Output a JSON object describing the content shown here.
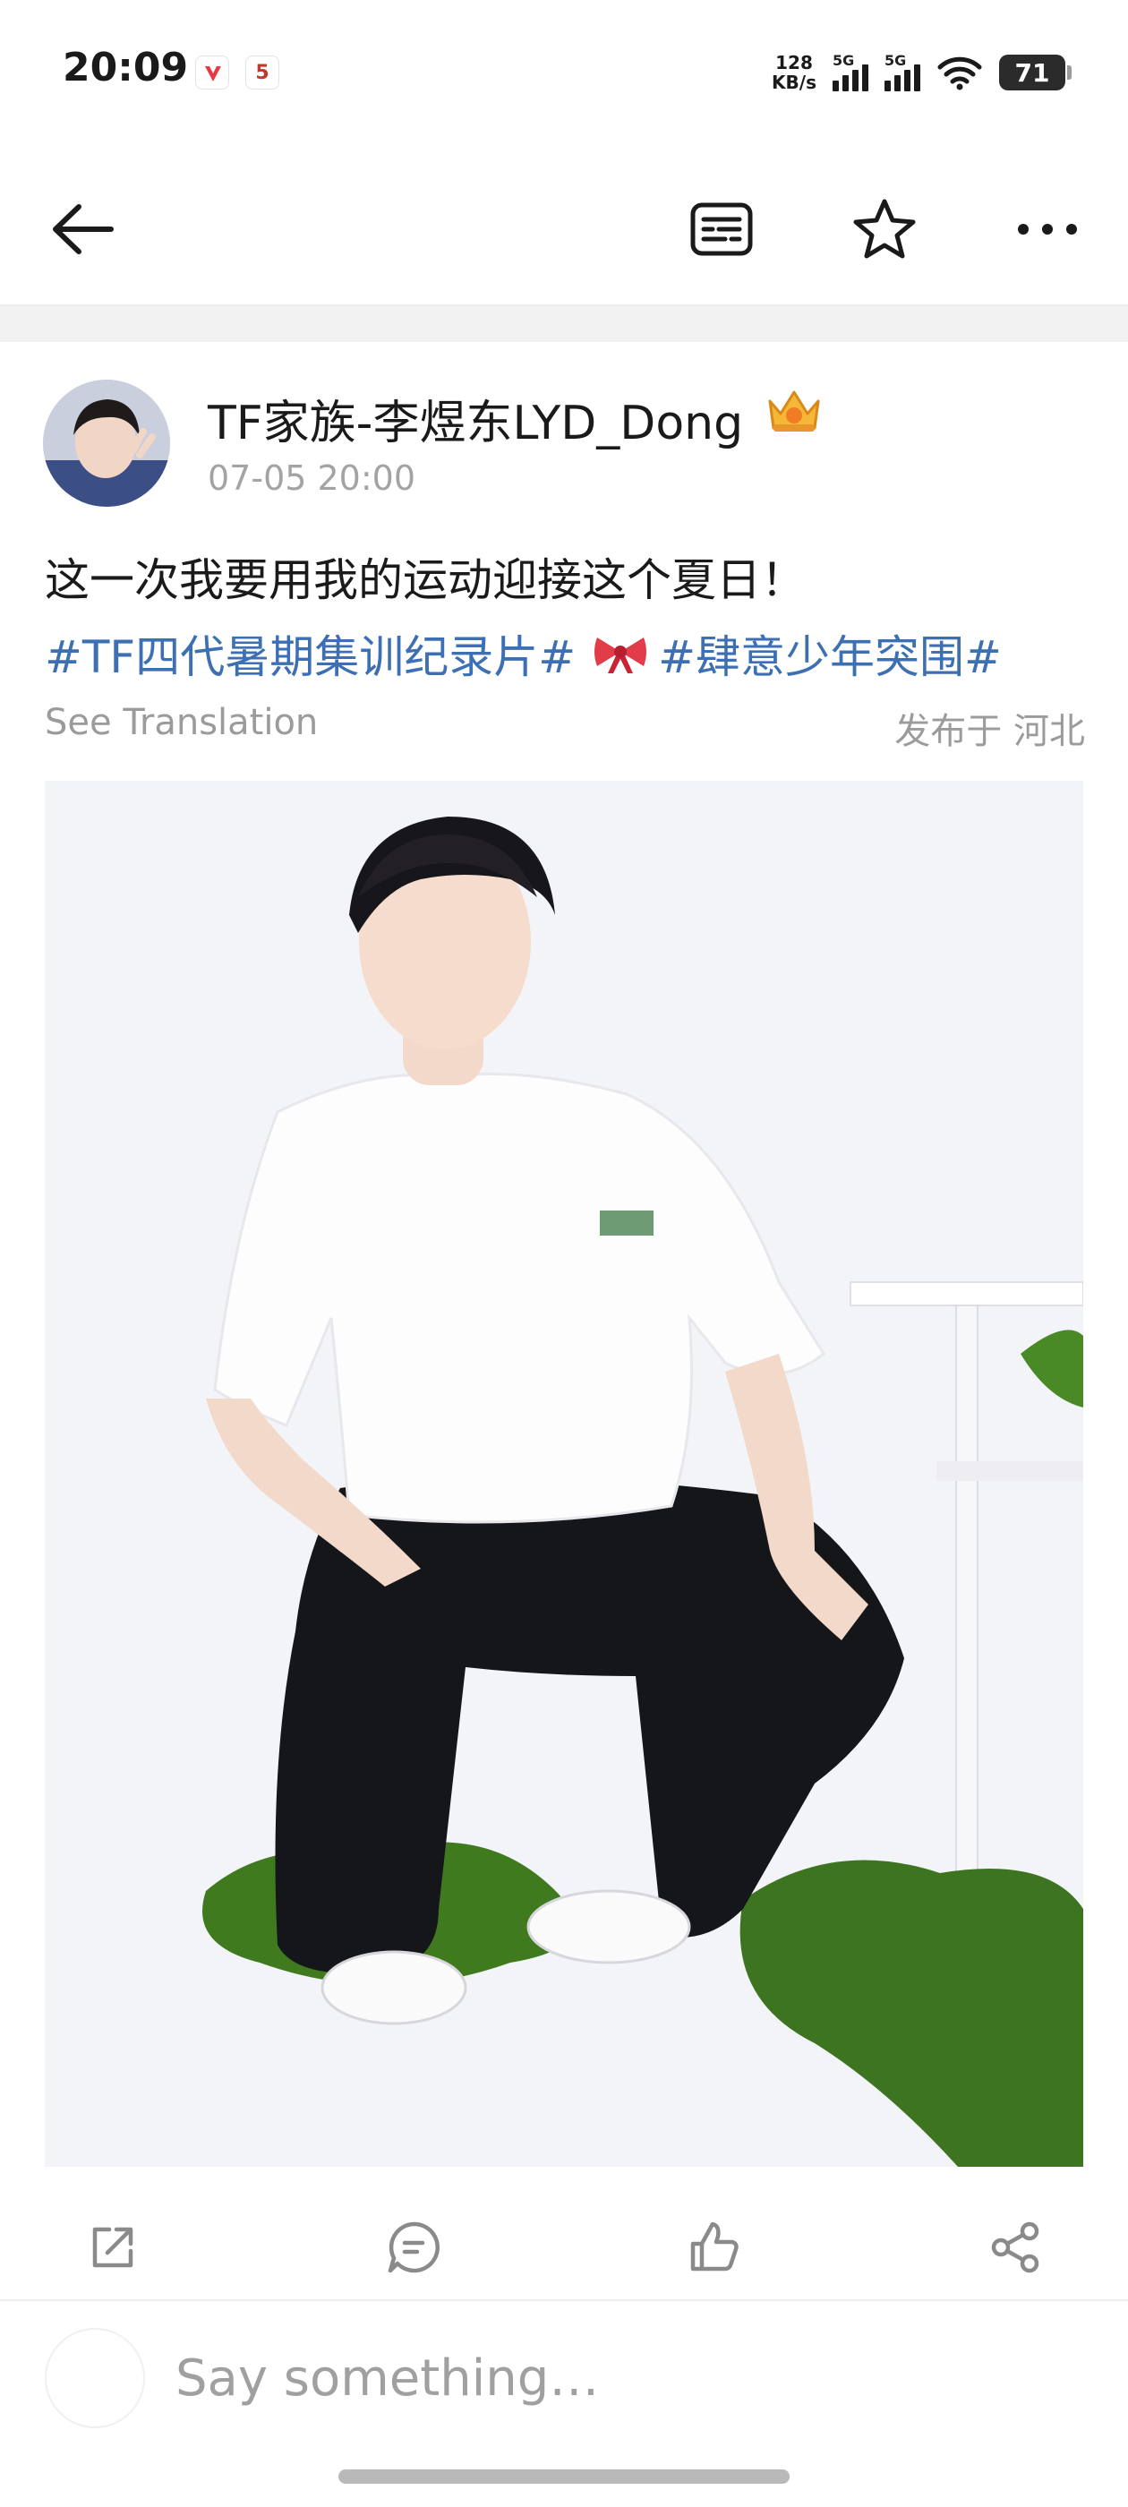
{
  "status_bar": {
    "time": "20:09",
    "app2_badge": "5",
    "net_speed_value": "128",
    "net_speed_unit": "KB/s",
    "sim1_label": "5G",
    "sim2_label": "5G",
    "battery": "71"
  },
  "topnav": {
    "back_icon": "arrow-left-icon",
    "reader_icon": "reader-mode-icon",
    "favorite_icon": "star-icon",
    "more_icon": "more-dots-icon"
  },
  "post": {
    "author": "TF家族-李煜东LYD_Dong",
    "author_badge_icon": "crown-icon",
    "time": "07-05 20:00",
    "text": "这一次我要用我的运动迎接这个夏日！",
    "tag1": "#TF四代暑期集训纪录片#",
    "tag2": "#肆意少年突围#",
    "see_translation": "See Translation",
    "location": "发布于 河北"
  },
  "actions": {
    "repost_icon": "repost-icon",
    "comment_icon": "comment-icon",
    "like_icon": "like-icon",
    "share_icon": "share-icon"
  },
  "comment": {
    "placeholder": "Say something…"
  },
  "colors": {
    "tag": "#3c6fb3",
    "muted": "#9b9b9b",
    "text": "#1a1a1a"
  }
}
